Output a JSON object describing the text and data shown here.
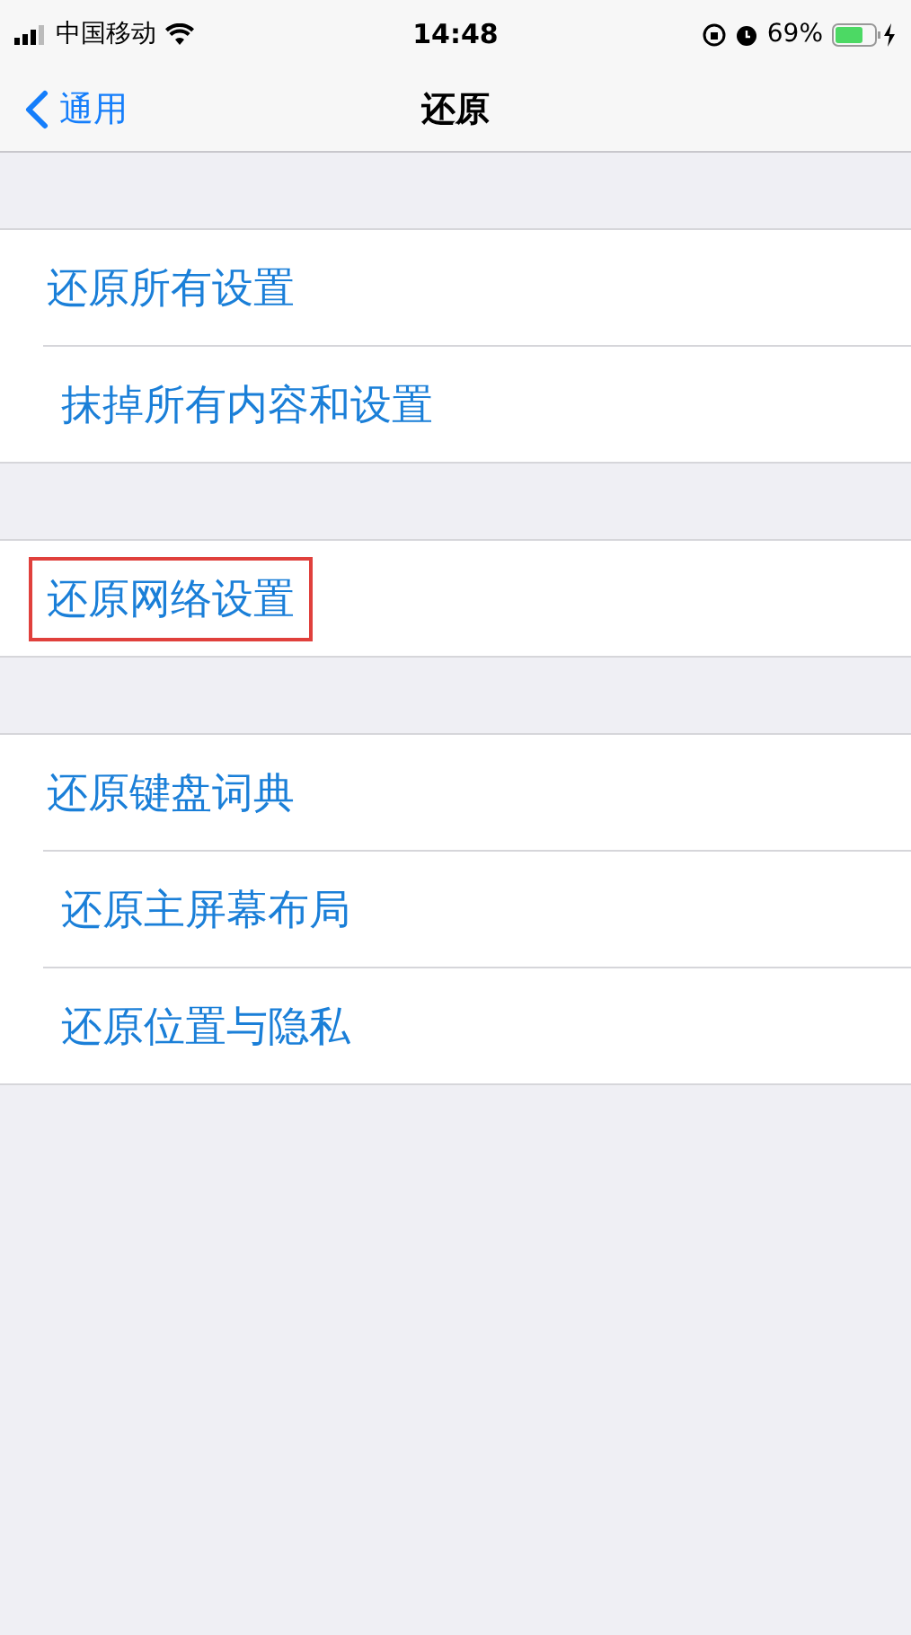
{
  "status_bar": {
    "carrier": "中国移动",
    "time": "14:48",
    "battery": "69%"
  },
  "nav": {
    "back": "通用",
    "title": "还原"
  },
  "groups": [
    {
      "items": [
        {
          "label": "还原所有设置",
          "highlighted": false
        },
        {
          "label": "抹掉所有内容和设置",
          "highlighted": false
        }
      ]
    },
    {
      "items": [
        {
          "label": "还原网络设置",
          "highlighted": true
        }
      ]
    },
    {
      "items": [
        {
          "label": "还原键盘词典",
          "highlighted": false
        },
        {
          "label": "还原主屏幕布局",
          "highlighted": false
        },
        {
          "label": "还原位置与隐私",
          "highlighted": false
        }
      ]
    }
  ]
}
